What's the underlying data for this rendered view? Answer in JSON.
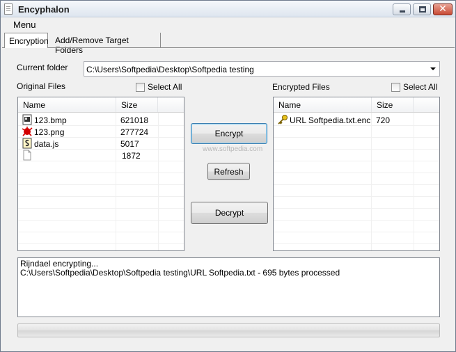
{
  "window": {
    "title": "Encyphalon"
  },
  "menu": {
    "items": [
      "Menu"
    ]
  },
  "tabs": [
    {
      "label": "Encryption",
      "active": true
    },
    {
      "label": "Add/Remove Target Folders",
      "active": false
    }
  ],
  "current_folder": {
    "label": "Current folder",
    "value": "C:\\Users\\Softpedia\\Desktop\\Softpedia testing"
  },
  "original_files": {
    "label": "Original Files",
    "select_all_label": "Select All",
    "select_all_checked": false,
    "columns": [
      "Name",
      "Size"
    ],
    "rows": [
      {
        "icon": "bitmap-file-icon",
        "name": "123.bmp",
        "size": "621018"
      },
      {
        "icon": "png-file-icon",
        "name": "123.png",
        "size": "277724"
      },
      {
        "icon": "script-file-icon",
        "name": "data.js",
        "size": "5017"
      },
      {
        "icon": "blank-file-icon",
        "name": "",
        "size": "1872"
      }
    ]
  },
  "encrypted_files": {
    "label": "Encrypted Files",
    "select_all_label": "Select All",
    "select_all_checked": false,
    "columns": [
      "Name",
      "Size"
    ],
    "rows": [
      {
        "icon": "key-file-icon",
        "name": "URL Softpedia.txt.enc",
        "size": "720"
      }
    ]
  },
  "buttons": {
    "encrypt": "Encrypt",
    "refresh": "Refresh",
    "decrypt": "Decrypt"
  },
  "watermark": "www.softpedia.com",
  "log": {
    "lines": [
      "Rijndael encrypting...",
      "C:\\Users\\Softpedia\\Desktop\\Softpedia testing\\URL Softpedia.txt - 695 bytes processed"
    ]
  },
  "progress": {
    "value": 0
  }
}
